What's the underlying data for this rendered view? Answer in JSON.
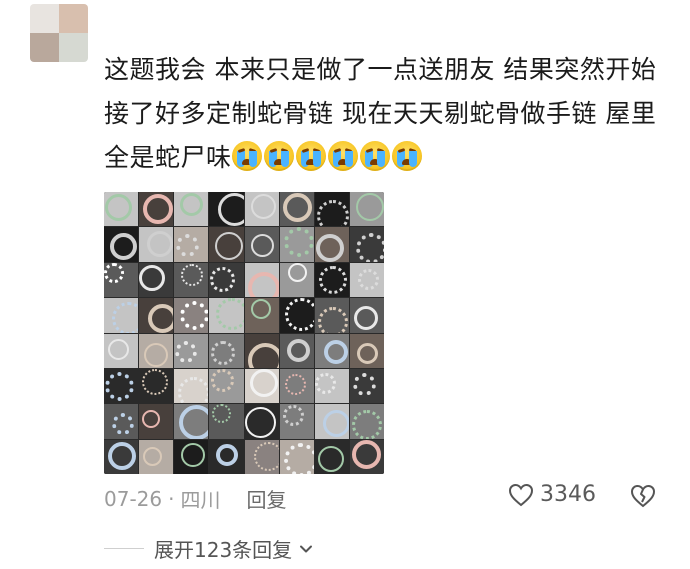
{
  "comment": {
    "text": "这题我会 本来只是做了一点送朋友 结果突然开始接了好多定制蛇骨链 现在天天剔蛇骨做手链 屋里全是蛇尸味",
    "emoji_count": 6,
    "emoji_icon": "loudly-crying-face-icon"
  },
  "avatar": {
    "colors": [
      "#e8e4e0",
      "#d8bfae",
      "#b9a89c",
      "#d6d9d2"
    ]
  },
  "photo": {
    "description_icon": "bracelet-collage-image"
  },
  "meta": {
    "date": "07-26",
    "separator": "·",
    "location": "四川",
    "reply_label": "回复"
  },
  "likes": {
    "count": "3346",
    "heart_icon": "heart-outline-icon",
    "dislike_icon": "broken-heart-icon"
  },
  "expand": {
    "label": "展开123条回复",
    "chevron_icon": "chevron-down-icon"
  }
}
